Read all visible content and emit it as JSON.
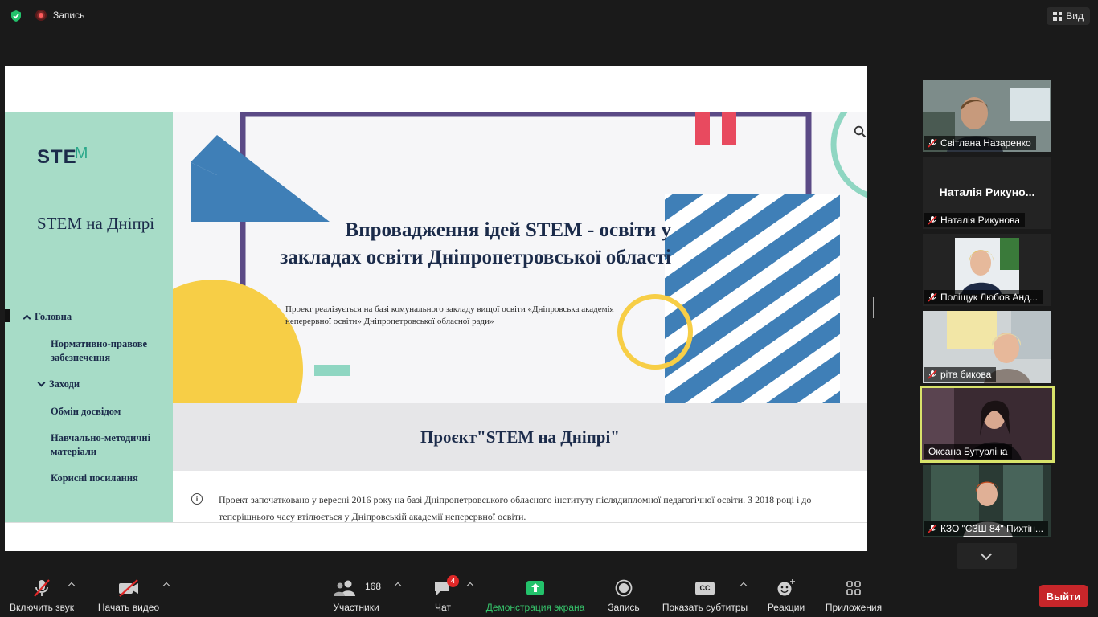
{
  "topbar": {
    "recording_label": "Запись",
    "view_label": "Вид"
  },
  "shared_screen": {
    "site": {
      "logo_text": "STE",
      "logo_accent": "M",
      "title": "STEM на Дніпрі",
      "nav": [
        {
          "label": "Головна"
        },
        {
          "label": "Нормативно-правове забезпечення"
        },
        {
          "label": "Заходи"
        },
        {
          "label": "Обмін досвідом"
        },
        {
          "label": "Навчально-методичні матеріали"
        },
        {
          "label": "Корисні посилання"
        }
      ],
      "hero_title": "Впровадження ідей STEM - освіти у закладах освіти Дніпропетровської області",
      "hero_subtitle": "Проект реалізується на базі комунального закладу вищої освіти «Дніпровська академія неперервної освіти» Дніпропетровської обласної ради»",
      "project_title": "Проєкт\"STEM на Дніпрі\"",
      "info_text": "Проект започатковано у вересні 2016 року на базі Дніпропетровського обласного інституту післядипломної педагогічної освіти. З 2018 році і до теперішнього часу втілюється у Дніпровській академії неперервної освіти."
    },
    "colors": {
      "sidebar": "#a7dcc7",
      "navy": "#1b2b4a",
      "blue_shape": "#3f7fb7",
      "purple_frame": "#5b4a86",
      "yellow": "#f7ce46",
      "red": "#e84a5f",
      "teal": "#8fd6c2"
    }
  },
  "participants": [
    {
      "name": "Світлана Назаренко"
    },
    {
      "name": "Наталія Рикунова",
      "display": "Наталія  Рикуно..."
    },
    {
      "name": "Поліщук Любов Анд..."
    },
    {
      "name": "ріта бикова"
    },
    {
      "name": "Оксана Бутурліна",
      "speaking": true
    },
    {
      "name": "КЗО \"СЗШ 84\" Пихтін..."
    }
  ],
  "toolbar": {
    "audio": "Включить звук",
    "video": "Начать видео",
    "participants": "Участники",
    "participants_count": "168",
    "chat": "Чат",
    "chat_badge": "4",
    "share": "Демонстрация экрана",
    "record": "Запись",
    "captions": "Показать субтитры",
    "captions_icon_text": "CC",
    "reactions": "Реакции",
    "apps": "Приложения",
    "leave": "Выйти"
  }
}
